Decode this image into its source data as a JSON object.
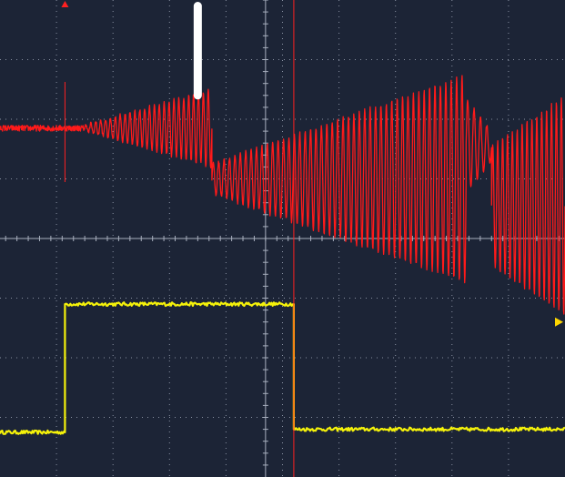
{
  "chart_data": {
    "type": "line",
    "title": "",
    "xlabel": "",
    "ylabel": "",
    "grid": true,
    "x_divisions": 10,
    "y_divisions": 8,
    "xlim": [
      -4.7,
      5.3
    ],
    "ylim": [
      -4,
      4
    ],
    "series": [
      {
        "color": "#ff1a1a",
        "segments": [
          {
            "kind": "flat",
            "x_start": -4.7,
            "x_end": -3.2,
            "center": 1.85,
            "noise": 0.05
          },
          {
            "kind": "oscillation",
            "x_start": -3.2,
            "x_end": -0.95,
            "center": 1.85,
            "amplitude_start": 0.05,
            "amplitude_end": 0.65,
            "cycles": 26
          },
          {
            "kind": "oscillation",
            "x_start": -0.95,
            "x_end": 3.55,
            "center": 1.0,
            "amplitude_start": 0.25,
            "amplitude_end": 1.75,
            "cycles": 47
          },
          {
            "kind": "oscillation",
            "x_start": 3.55,
            "x_end": 4.0,
            "center": 1.55,
            "amplitude_start": 0.8,
            "amplitude_end": 0.25,
            "cycles": 4
          },
          {
            "kind": "oscillation",
            "x_start": 4.0,
            "x_end": 5.3,
            "center": 0.55,
            "amplitude_start": 1.0,
            "amplitude_end": 1.85,
            "cycles": 15
          }
        ]
      },
      {
        "color": "#f5f20a",
        "points": [
          [
            -4.7,
            -3.25
          ],
          [
            -3.55,
            -3.25
          ],
          [
            -3.55,
            -1.1
          ],
          [
            -0.05,
            -1.1
          ],
          [
            0.5,
            -1.1
          ],
          [
            0.5,
            -3.2
          ],
          [
            5.3,
            -3.2
          ]
        ],
        "noise": 0.03
      }
    ],
    "markers": [
      {
        "name": "trigger-position",
        "color": "#ff2020",
        "x": -3.55,
        "y": 4
      },
      {
        "name": "trigger-level",
        "color": "#ffd700",
        "x": 5.3,
        "y": -1.4
      },
      {
        "name": "cursor",
        "color": "#ffffff",
        "x": -1.2,
        "y_start": 3.9,
        "y_end": 2.4
      },
      {
        "name": "time-cursor",
        "color": "#ff2020",
        "x": 0.5,
        "y_start": 4,
        "y_end": -4
      }
    ]
  }
}
